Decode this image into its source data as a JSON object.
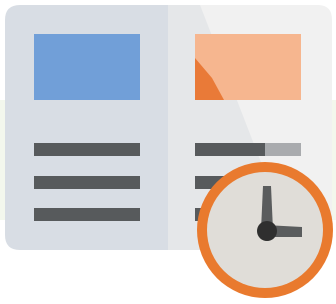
{
  "icon": {
    "name": "scheduled-post-icon",
    "depicts": [
      "open-document-icon",
      "clock-icon"
    ]
  },
  "colors": {
    "background_top": "#ffffff",
    "background_band": "#e9f1df",
    "doc_left": "#d8dde4",
    "doc_right": "#f1f1f1",
    "doc_shadow": "#e2e3e6",
    "blue_block": "#719fd8",
    "orange_block": "#f6b68f",
    "orange_fold": "#e97a38",
    "text_line": "#575a5c",
    "text_line_light": "#a9abae",
    "clock_ring": "#e97a2e",
    "clock_face": "#e0ddd8",
    "clock_hands": "#5a5c5d",
    "clock_center": "#2f2f2f"
  }
}
